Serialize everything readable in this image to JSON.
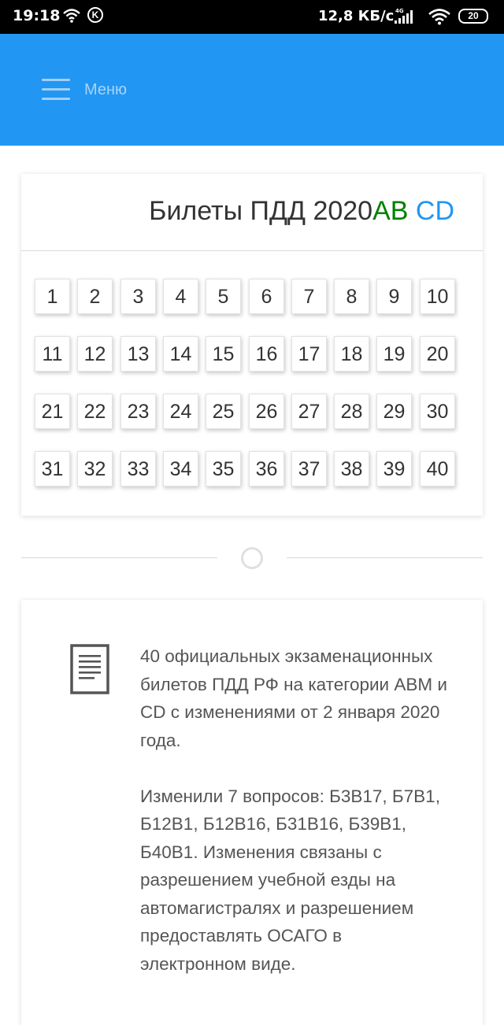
{
  "status_bar": {
    "time": "19:18",
    "k_label": "K",
    "speed": "12,8 КБ/с",
    "network": "4G",
    "battery": "20"
  },
  "header": {
    "menu_label": "Меню",
    "color": "#2196f3"
  },
  "tickets_card": {
    "title": "Билеты ПДД 2020",
    "title_ab": "AB",
    "title_cd": "CD",
    "tickets": [
      "1",
      "2",
      "3",
      "4",
      "5",
      "6",
      "7",
      "8",
      "9",
      "10",
      "11",
      "12",
      "13",
      "14",
      "15",
      "16",
      "17",
      "18",
      "19",
      "20",
      "21",
      "22",
      "23",
      "24",
      "25",
      "26",
      "27",
      "28",
      "29",
      "30",
      "31",
      "32",
      "33",
      "34",
      "35",
      "36",
      "37",
      "38",
      "39",
      "40"
    ]
  },
  "info_card": {
    "icon": "document-icon",
    "paragraph_1": "40 официальных экзаменационных билетов ПДД РФ на категории ABM и CD с изменениями от 2 января 2020 года.",
    "paragraph_2": "Изменили 7 вопросов: Б3В17, Б7В1, Б12В1, Б12В16, Б31В16, Б39В1, Б40В1. Изменения связаны с разрешением учебной езды на автомагистралях и разрешением предоставлять ОСАГО в электронном виде."
  }
}
